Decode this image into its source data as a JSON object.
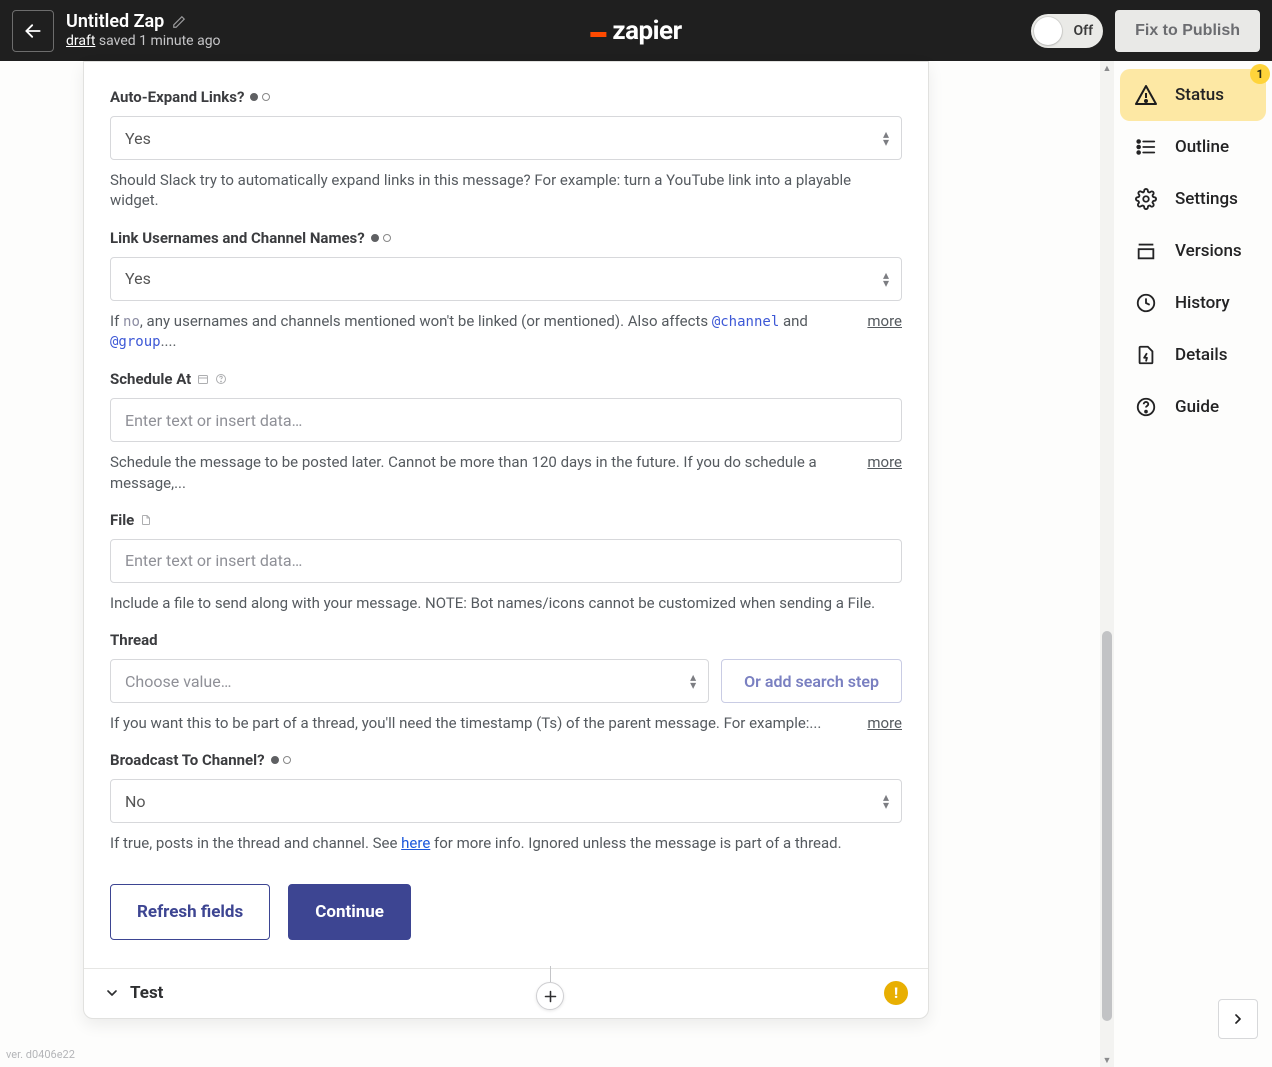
{
  "header": {
    "title": "Untitled Zap",
    "draft_label": "draft",
    "saved_text": " saved 1 minute ago",
    "logo_text": "zapier",
    "toggle_label": "Off",
    "publish_label": "Fix to Publish"
  },
  "fields": {
    "auto_expand": {
      "label": "Auto-Expand Links?",
      "value": "Yes",
      "helper": "Should Slack try to automatically expand links in this message? For example: turn a YouTube link into a playable widget."
    },
    "link_usernames": {
      "label": "Link Usernames and Channel Names?",
      "value": "Yes",
      "helper_prefix": "If ",
      "helper_code1": "no",
      "helper_mid": ", any usernames and channels mentioned won't be linked (or mentioned). Also affects ",
      "helper_code2": "@channel",
      "helper_and": " and ",
      "helper_code3": "@group",
      "helper_suffix": "....",
      "more": "more"
    },
    "schedule": {
      "label": "Schedule At",
      "placeholder": "Enter text or insert data…",
      "helper": "Schedule the message to be posted later. Cannot be more than 120 days in the future. If you do schedule a message,...",
      "more": "more"
    },
    "file": {
      "label": "File",
      "placeholder": "Enter text or insert data…",
      "helper": "Include a file to send along with your message. NOTE: Bot names/icons cannot be customized when sending a File."
    },
    "thread": {
      "label": "Thread",
      "placeholder": "Choose value…",
      "search_step": "Or add search step",
      "helper": "If you want this to be part of a thread, you'll need the timestamp (Ts) of the parent message. For example:...",
      "more": "more"
    },
    "broadcast": {
      "label": "Broadcast To Channel?",
      "value": "No",
      "helper_prefix": "If true, posts in the thread and channel. See ",
      "helper_link": "here",
      "helper_suffix": " for more info. Ignored unless the message is part of a thread."
    }
  },
  "buttons": {
    "refresh": "Refresh fields",
    "continue": "Continue"
  },
  "test_section": {
    "label": "Test",
    "warn": "!"
  },
  "sidebar": {
    "items": [
      {
        "label": "Status",
        "badge": "1"
      },
      {
        "label": "Outline"
      },
      {
        "label": "Settings"
      },
      {
        "label": "Versions"
      },
      {
        "label": "History"
      },
      {
        "label": "Details"
      },
      {
        "label": "Guide"
      }
    ]
  },
  "version": "ver. d0406e22"
}
